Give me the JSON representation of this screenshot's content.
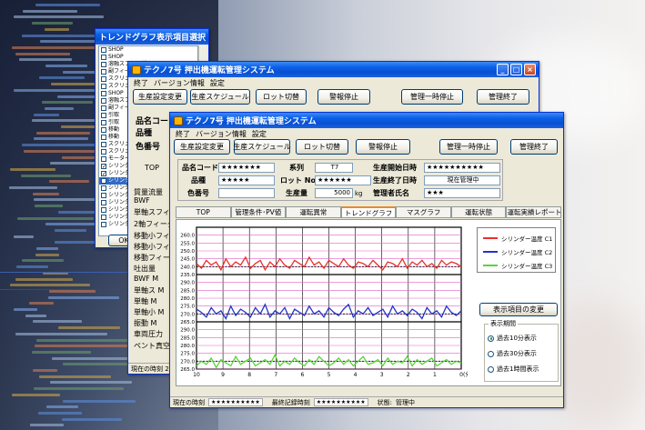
{
  "win_back1": {
    "title": "トレンドグラフ表示項目選択",
    "items": [
      {
        "label": "SHOP",
        "checked": false
      },
      {
        "label": "SHOP",
        "checked": false
      },
      {
        "label": "溶融スフィーダー",
        "checked": false
      },
      {
        "label": "副フィーダー",
        "checked": false
      },
      {
        "label": "スクリュー",
        "checked": false
      },
      {
        "label": "スクリュー",
        "checked": false
      },
      {
        "label": "SHOP",
        "checked": false
      },
      {
        "label": "溶融スフィーダー",
        "checked": false
      },
      {
        "label": "副フィーダー",
        "checked": false
      },
      {
        "label": "引取",
        "checked": false
      },
      {
        "label": "引取",
        "checked": false
      },
      {
        "label": "移動",
        "checked": false
      },
      {
        "label": "移動",
        "checked": false
      },
      {
        "label": "スクリュー",
        "checked": false
      },
      {
        "label": "スクリュー",
        "checked": false
      },
      {
        "label": "モーター",
        "checked": false
      },
      {
        "label": "シリンダー",
        "checked": true
      },
      {
        "label": "シリンダー",
        "checked": true
      },
      {
        "label": "シリンダー",
        "checked": true
      },
      {
        "label": "シリンダー",
        "checked": false
      },
      {
        "label": "シリンダー",
        "checked": false
      },
      {
        "label": "シリンダー",
        "checked": false
      },
      {
        "label": "シリンダー",
        "checked": false
      },
      {
        "label": "シリンダー",
        "checked": false
      },
      {
        "label": "シリンダー",
        "checked": false
      }
    ],
    "ok_label": "OK"
  },
  "win_back2": {
    "title": "テクノ7号 押出機運転管理システム",
    "menu": [
      "終了",
      "バージョン情報",
      "設定"
    ],
    "buttons": [
      "生産設定変更",
      "生産スケジュール",
      "ロット切替",
      "警報停止",
      "管理一時停止",
      "管理終了"
    ],
    "side_labels": [
      "品名コード",
      "品種",
      "色番号",
      "TOP",
      "質量流量",
      "BWF",
      "単軸スフィーダ",
      "2軸フィーダ",
      "移動小フィーダ",
      "移動小フィーダ",
      "移動フィーダ",
      "吐出量",
      "BWF M",
      "単軸ス M",
      "単軸 M",
      "単軸小 M",
      "振動 M",
      "車両圧力",
      "ペント真空度"
    ],
    "status": "現在の時刻 2012"
  },
  "main": {
    "title": "テクノ7号 押出機運転管理システム",
    "menu": [
      "終了",
      "バージョン情報",
      "設定"
    ],
    "buttons": [
      "生産設定変更",
      "生産スケジュール",
      "ロット切替",
      "警報停止",
      "管理一時停止",
      "管理終了"
    ],
    "info": {
      "product_code_label": "品名コード",
      "product_code": "★★★★★★★",
      "series_label": "系列",
      "series": "T7",
      "start_label": "生産開始日時",
      "start": "★★★★★★★★★★",
      "grade_label": "品種",
      "grade": "★★★★★",
      "lot_label": "ロット No.",
      "lot": "★★★★★★",
      "end_label": "生産終了日時",
      "end": "現在管理中",
      "color_label": "色番号",
      "color": "",
      "amount_label": "生産量",
      "amount": "5000",
      "amount_unit": "kg",
      "manager_label": "管理者氏名",
      "manager": "★★★"
    },
    "tabs": [
      "TOP",
      "管理条件･PV値",
      "運転異常",
      "トレンドグラフ",
      "マスグラフ",
      "運転状態",
      "運転実績レポート"
    ],
    "active_tab": 3,
    "change_items_button": "表示項目の変更",
    "period": {
      "title": "表示期間",
      "options": [
        "過去10分表示",
        "過去30分表示",
        "過去1時間表示"
      ],
      "selected": 0
    },
    "status": {
      "time_label": "現在の時刻",
      "time": "★★★★★★★★★★",
      "last_label": "最終記録時刻",
      "last": "★★★★★★★★★★",
      "state_label": "状態:",
      "state": "管理中"
    }
  },
  "chart_data": {
    "type": "line",
    "xlabel": "(分)",
    "x_ticks": [
      "10",
      "9",
      "8",
      "7",
      "6",
      "5",
      "4",
      "3",
      "2",
      "1",
      "0"
    ],
    "panels": [
      {
        "series": "シリンダー温度 C1",
        "color": "#e8302a",
        "ylim": [
          235,
          265
        ],
        "ticks": [
          "260.0",
          "255.0",
          "250.0",
          "245.0",
          "240.0",
          "235.0"
        ],
        "setpoint": 240,
        "values": [
          242,
          239,
          244,
          241,
          243,
          238,
          245,
          240,
          243,
          241,
          246,
          239,
          242,
          244,
          238,
          243,
          240,
          245,
          241,
          239,
          244,
          242,
          240,
          246,
          241,
          243,
          239,
          244,
          242,
          240,
          245,
          241,
          239,
          243,
          242,
          240,
          244,
          241,
          238,
          243,
          242,
          240,
          245,
          239,
          243,
          241,
          244,
          240,
          242,
          239,
          244,
          241,
          243,
          242,
          240
        ]
      },
      {
        "series": "シリンダー温度 C2",
        "color": "#2234c8",
        "ylim": [
          265,
          295
        ],
        "ticks": [
          "290.0",
          "285.0",
          "280.0",
          "275.0",
          "270.0",
          "265.0"
        ],
        "setpoint": 270,
        "values": [
          273,
          271,
          268,
          274,
          270,
          272,
          267,
          275,
          269,
          273,
          271,
          268,
          274,
          270,
          276,
          268,
          272,
          270,
          274,
          267,
          273,
          271,
          269,
          275,
          270,
          272,
          268,
          274,
          271,
          269,
          273,
          276,
          268,
          272,
          270,
          274,
          269,
          271,
          273,
          268,
          275,
          270,
          272,
          269,
          273,
          271,
          267,
          274,
          270,
          272,
          268,
          275,
          271,
          269,
          272
        ]
      },
      {
        "series": "シリンダー温度 C3",
        "color": "#5ad43a",
        "ylim": [
          265,
          295
        ],
        "ticks": [
          "290.0",
          "285.0",
          "280.0",
          "275.0",
          "270.0",
          "265.0"
        ],
        "setpoint": 270,
        "values": [
          267,
          270,
          268,
          272,
          266,
          271,
          269,
          267,
          273,
          268,
          270,
          272,
          267,
          269,
          271,
          268,
          274,
          267,
          270,
          268,
          272,
          269,
          267,
          271,
          268,
          273,
          270,
          267,
          269,
          272,
          268,
          271,
          267,
          270,
          273,
          268,
          269,
          271,
          267,
          272,
          268,
          270,
          269,
          273,
          267,
          271,
          268,
          270,
          272,
          267,
          269,
          271,
          268,
          270,
          269
        ]
      }
    ]
  }
}
